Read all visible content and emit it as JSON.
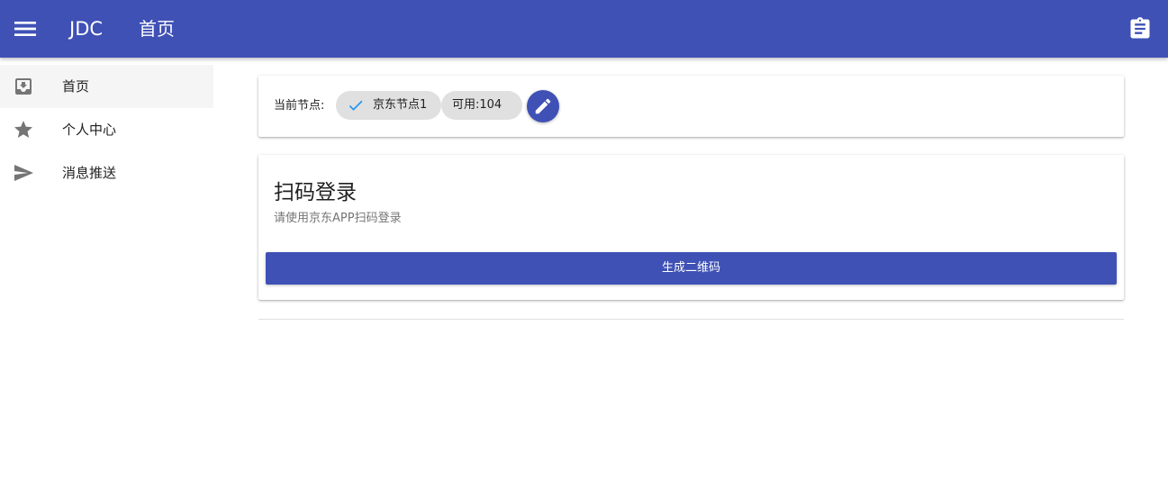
{
  "app_bar": {
    "brand": "JDC",
    "title": "首页",
    "menu_icon": "menu-icon",
    "action_icon": "clipboard-icon",
    "color": "#3f51b5"
  },
  "sidebar": {
    "items": [
      {
        "label": "首页",
        "icon": "inbox-download-icon",
        "active": true
      },
      {
        "label": "个人中心",
        "icon": "star-icon",
        "active": false
      },
      {
        "label": "消息推送",
        "icon": "send-icon",
        "active": false
      }
    ]
  },
  "node_card": {
    "label": "当前节点:",
    "node_chip": "京东节点1",
    "available_chip": "可用:104",
    "edit_icon": "pencil-icon",
    "check_icon": "check-icon",
    "check_color": "#2196f3"
  },
  "login_card": {
    "title": "扫码登录",
    "subtitle": "请使用京东APP扫码登录",
    "button_label": "生成二维码"
  }
}
